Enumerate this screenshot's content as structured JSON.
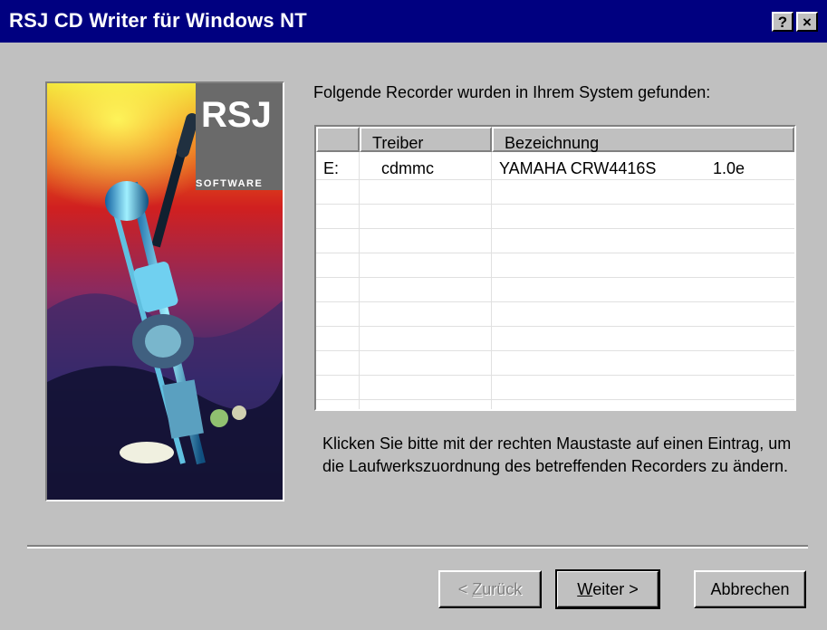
{
  "window": {
    "title": "RSJ CD Writer für Windows NT",
    "help_btn": "?",
    "close_btn": "×"
  },
  "art": {
    "logo": "RSJ",
    "logo_sub": "SOFTWARE"
  },
  "main": {
    "found_label": "Folgende Recorder wurden in Ihrem System gefunden:",
    "columns": [
      "",
      "Treiber",
      "Bezeichnung"
    ],
    "rows": [
      {
        "drive": "E:",
        "driver": "cdmmc",
        "name": "YAMAHA  CRW4416S",
        "version": "1.0e"
      }
    ],
    "hint": "Klicken Sie bitte mit der rechten Maustaste auf einen Eintrag, um die Laufwerkszuordnung des betreffenden Recorders zu ändern."
  },
  "buttons": {
    "back_pre": "< ",
    "back_u": "Z",
    "back_post": "urück",
    "next_u": "W",
    "next_post": "eiter >",
    "cancel": "Abbrechen"
  }
}
